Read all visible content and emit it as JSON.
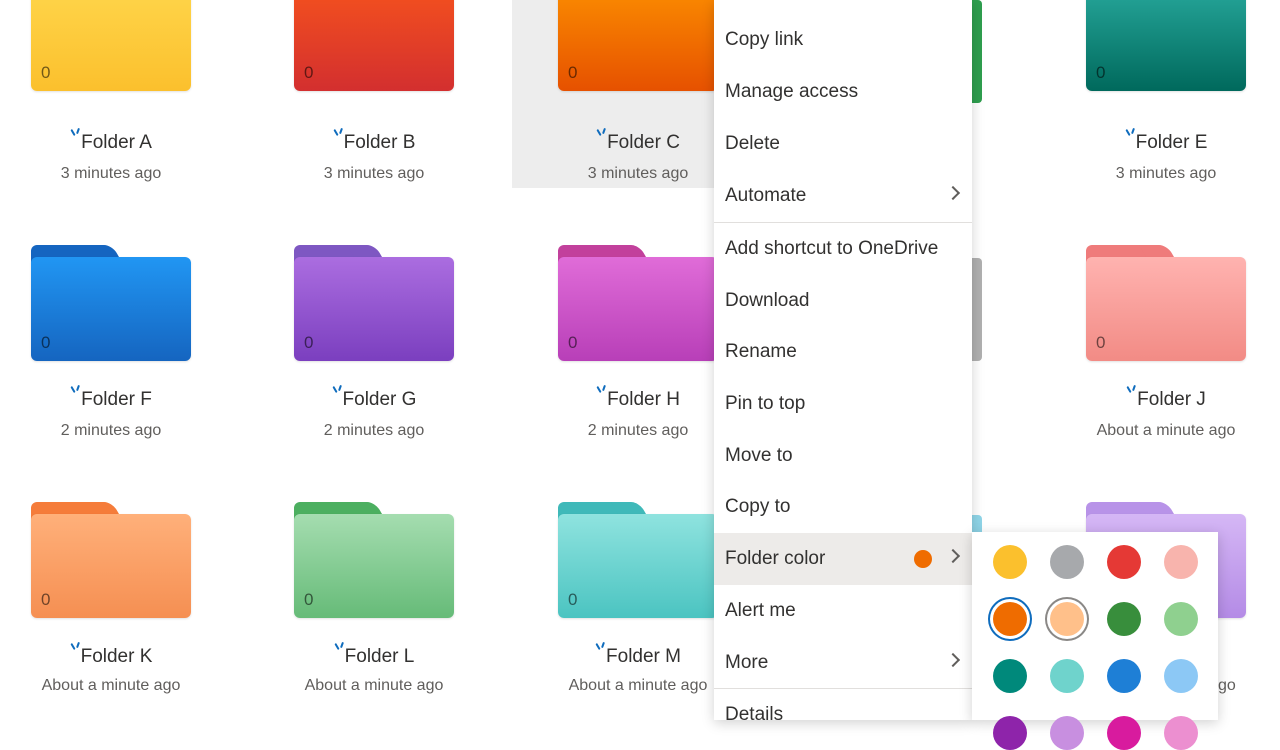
{
  "folders": [
    {
      "name": "Folder A",
      "time": "3 minutes ago",
      "count": "0",
      "color": "#fbc02d",
      "body_top": "#ffd54a",
      "body_bottom": "#fbc02d"
    },
    {
      "name": "Folder B",
      "time": "3 minutes ago",
      "count": "0",
      "color": "#e53935",
      "body_top": "#f4511e",
      "body_bottom": "#d32f2f"
    },
    {
      "name": "Folder C",
      "time": "3 minutes ago",
      "count": "0",
      "color": "#ef6c00",
      "body_top": "#fb8c00",
      "body_bottom": "#e65100"
    },
    {
      "name": "Folder E",
      "time": "3 minutes ago",
      "count": "0",
      "color": "#00796b",
      "body_top": "#26a69a",
      "body_bottom": "#00695c"
    },
    {
      "name": "Folder F",
      "time": "2 minutes ago",
      "count": "0",
      "color": "#1565c0",
      "body_top": "#2196f3",
      "body_bottom": "#1565c0"
    },
    {
      "name": "Folder G",
      "time": "2 minutes ago",
      "count": "0",
      "color": "#7e57c2",
      "body_top": "#ab6de0",
      "body_bottom": "#7b3fbf"
    },
    {
      "name": "Folder H",
      "time": "2 minutes ago",
      "count": "0",
      "color": "#c2409c",
      "body_top": "#e06cd8",
      "body_bottom": "#b83fb8"
    },
    {
      "name": "Folder J",
      "time": "About a minute ago",
      "count": "0",
      "color": "#ef7b7b",
      "body_top": "#ffb3b0",
      "body_bottom": "#f28b85"
    },
    {
      "name": "Folder K",
      "time": "About a minute ago",
      "count": "0",
      "color": "#f57c3a",
      "body_top": "#ffb07a",
      "body_bottom": "#f58f52"
    },
    {
      "name": "Folder L",
      "time": "About a minute ago",
      "count": "0",
      "color": "#4caf60",
      "body_top": "#a5ddb0",
      "body_bottom": "#66bb78"
    },
    {
      "name": "Folder M",
      "time": "About a minute ago",
      "count": "0",
      "color": "#3fb9b9",
      "body_top": "#8fe3df",
      "body_bottom": "#4bc4c1"
    }
  ],
  "partial": {
    "time_suffix": "go"
  },
  "menu": {
    "items": [
      {
        "label": "Copy link"
      },
      {
        "label": "Manage access"
      },
      {
        "label": "Delete"
      },
      {
        "label": "Automate"
      },
      {
        "label": "Add shortcut to OneDrive"
      },
      {
        "label": "Download"
      },
      {
        "label": "Rename"
      },
      {
        "label": "Pin to top"
      },
      {
        "label": "Move to"
      },
      {
        "label": "Copy to"
      },
      {
        "label": "Folder color"
      },
      {
        "label": "Alert me"
      },
      {
        "label": "More"
      },
      {
        "label": "Details"
      }
    ],
    "current_color": "#ef6c00"
  },
  "palette": {
    "colors": [
      "#fbc02d",
      "#a7a9ac",
      "#e53935",
      "#f8b4ad",
      "#ef6c00",
      "#ffc08a",
      "#388e3c",
      "#8fd08f",
      "#00897b",
      "#6fd3cc",
      "#1e7fd6",
      "#8cc8f5",
      "#8e24aa",
      "#c88fe0",
      "#d81b9e",
      "#ec8fd0"
    ],
    "selected_index": 4
  },
  "colors": {
    "accent": "#0f6cbd",
    "hover": "#edebe9"
  }
}
